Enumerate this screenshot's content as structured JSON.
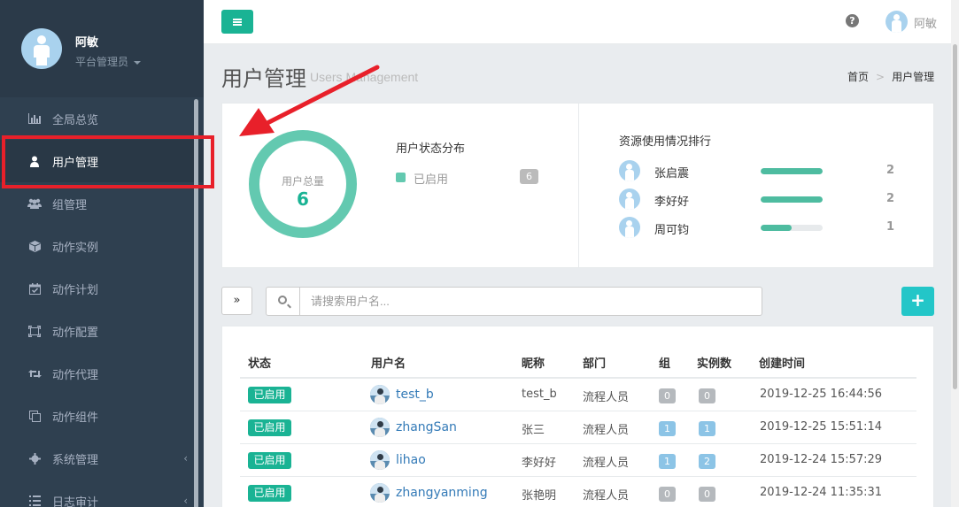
{
  "sidebar": {
    "profile": {
      "name": "阿敏",
      "role": "平台管理员"
    },
    "items": [
      {
        "label": "全局总览",
        "icon": "bar-chart-icon"
      },
      {
        "label": "用户管理",
        "icon": "user-icon",
        "active": true
      },
      {
        "label": "组管理",
        "icon": "users-icon"
      },
      {
        "label": "动作实例",
        "icon": "cube-icon"
      },
      {
        "label": "动作计划",
        "icon": "calendar-check-icon"
      },
      {
        "label": "动作配置",
        "icon": "expand-icon"
      },
      {
        "label": "动作代理",
        "icon": "retweet-icon"
      },
      {
        "label": "动作组件",
        "icon": "clone-icon"
      },
      {
        "label": "系统管理",
        "icon": "gear-icon"
      },
      {
        "label": "日志审计",
        "icon": "list-icon"
      }
    ]
  },
  "topbar": {
    "user_name": "阿敏"
  },
  "page": {
    "title": "用户管理",
    "subtitle": "Users Management",
    "breadcrumb": [
      "首页",
      "用户管理"
    ]
  },
  "stats": {
    "donut_label": "用户总量",
    "donut_value": "6",
    "status_title": "用户状态分布",
    "legend": {
      "label": "已启用",
      "count": "6"
    },
    "ranking_title": "资源使用情况排行",
    "ranking": [
      {
        "name": "张启震",
        "value": "2",
        "fill": 1.0
      },
      {
        "name": "李好好",
        "value": "2",
        "fill": 1.0
      },
      {
        "name": "周可钧",
        "value": "1",
        "fill": 0.5
      }
    ]
  },
  "search": {
    "expand_label": "»",
    "placeholder": "请搜索用户名...",
    "add_label": "+"
  },
  "table": {
    "headers": [
      "状态",
      "用户名",
      "昵称",
      "部门",
      "组",
      "实例数",
      "创建时间"
    ],
    "rows": [
      {
        "status": "已启用",
        "username": "test_b",
        "nickname": "test_b",
        "dept": "流程人员",
        "group": "0",
        "instances": "0",
        "created": "2019-12-25 16:44:56"
      },
      {
        "status": "已启用",
        "username": "zhangSan",
        "nickname": "张三",
        "dept": "流程人员",
        "group": "1",
        "instances": "1",
        "created": "2019-12-25 15:51:14"
      },
      {
        "status": "已启用",
        "username": "lihao",
        "nickname": "李好好",
        "dept": "流程人员",
        "group": "1",
        "instances": "2",
        "created": "2019-12-24 15:57:29"
      },
      {
        "status": "已启用",
        "username": "zhangyanming",
        "nickname": "张艳明",
        "dept": "流程人员",
        "group": "0",
        "instances": "0",
        "created": "2019-12-24 11:35:31"
      }
    ]
  },
  "colors": {
    "accent": "#1ab394",
    "sidebar": "#2f4050",
    "annotation": "#e8202a"
  }
}
